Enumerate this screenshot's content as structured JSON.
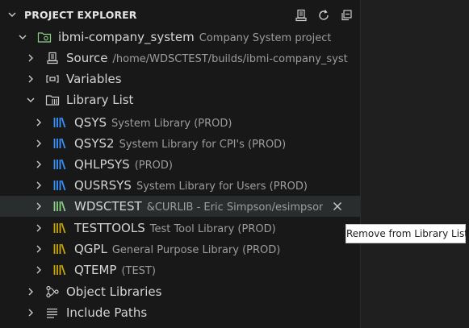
{
  "panel": {
    "title": "PROJECT EXPLORER",
    "actions": [
      {
        "icon": "server-icon"
      },
      {
        "icon": "refresh-icon"
      },
      {
        "icon": "collapse-all-icon"
      }
    ]
  },
  "tree": {
    "project": {
      "label": "ibmi-company_system",
      "description": "Company System project"
    },
    "source": {
      "label": "Source",
      "description": "/home/WDSCTEST/builds/ibmi-company_syst..."
    },
    "variables": {
      "label": "Variables"
    },
    "library_list": {
      "label": "Library List"
    },
    "libraries": [
      {
        "name": "QSYS",
        "description": "System Library (PROD)",
        "color": "#3794ff"
      },
      {
        "name": "QSYS2",
        "description": "System Library for CPI's (PROD)",
        "color": "#3794ff"
      },
      {
        "name": "QHLPSYS",
        "description": "(PROD)",
        "color": "#3794ff"
      },
      {
        "name": "QUSRSYS",
        "description": "System Library for Users (PROD)",
        "color": "#3794ff"
      },
      {
        "name": "WDSCTEST",
        "description": "&CURLIB - Eric Simpson/esimpson...",
        "color": "#89d185"
      },
      {
        "name": "TESTTOOLS",
        "description": "Test Tool Library (PROD)",
        "color": "#cca700"
      },
      {
        "name": "QGPL",
        "description": "General Purpose Library (PROD)",
        "color": "#cca700"
      },
      {
        "name": "QTEMP",
        "description": "(TEST)",
        "color": "#cca700"
      }
    ],
    "object_libraries": {
      "label": "Object Libraries"
    },
    "include_paths": {
      "label": "Include Paths"
    }
  },
  "tooltip": {
    "text": "Remove from Library List"
  },
  "colors": {
    "background": "#181818",
    "hover_row": "#2a2d2e",
    "prod_library": "#3794ff",
    "current_library": "#89d185",
    "test_library": "#cca700"
  }
}
